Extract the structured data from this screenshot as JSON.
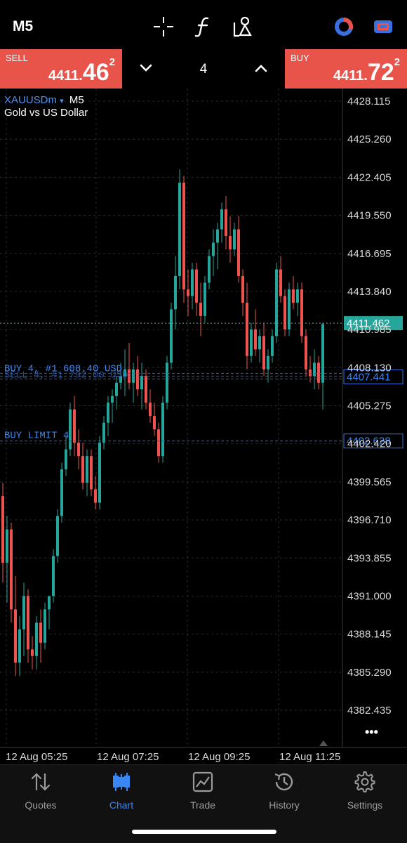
{
  "header": {
    "timeframe": "M5",
    "icons": [
      "crosshair-icon",
      "function-icon",
      "objects-icon",
      "account-icon",
      "switch-icon"
    ]
  },
  "trade_panel": {
    "sell": {
      "label": "SELL",
      "price_main": "4411.",
      "price_big": "46",
      "price_sup": "2"
    },
    "buy": {
      "label": "BUY",
      "price_main": "4411.",
      "price_big": "72",
      "price_sup": "2"
    },
    "quantity": "4"
  },
  "chart_info": {
    "symbol": "XAUUSDm",
    "symbol_arrow": "▾",
    "timeframe": "M5",
    "description": "Gold vs US Dollar"
  },
  "price_axis": {
    "ticks": [
      "4428.115",
      "4425.260",
      "4422.405",
      "4419.550",
      "4416.695",
      "4413.840",
      "4410.985",
      "4408.130",
      "4405.275",
      "4402.420",
      "4399.565",
      "4396.710",
      "4393.855",
      "4391.000",
      "4388.145",
      "4385.290",
      "4382.435"
    ],
    "current_price": "4411.462",
    "order_price": "4407.441",
    "limit_price": "4402.628"
  },
  "time_axis": {
    "ticks": [
      "12 Aug 05:25",
      "12 Aug 07:25",
      "12 Aug 09:25",
      "12 Aug 11:25"
    ]
  },
  "orders": {
    "buy_line_label": "BUY 4, #1 608.40 USD",
    "sell_line_label": "SELL 4, #1 792.00 USD",
    "limit_label": "BUY LIMIT 4"
  },
  "more_label": "•••",
  "colors": {
    "sell": "#e8534a",
    "buy": "#e8534a",
    "bull": "#26a69a",
    "bear": "#ef5350",
    "accent": "#3a86f5"
  },
  "chart_data": {
    "type": "candlestick",
    "symbol": "XAUUSDm",
    "ohlc": [
      [
        4398.5,
        4399.5,
        4392.0,
        4393.5
      ],
      [
        4393.5,
        4397.0,
        4390.5,
        4396.0
      ],
      [
        4396.0,
        4396.5,
        4389.0,
        4390.0
      ],
      [
        4390.0,
        4392.5,
        4385.0,
        4386.0
      ],
      [
        4386.0,
        4389.5,
        4385.0,
        4388.5
      ],
      [
        4388.5,
        4392.0,
        4386.5,
        4391.0
      ],
      [
        4391.0,
        4391.5,
        4386.0,
        4387.0
      ],
      [
        4387.0,
        4388.0,
        4385.5,
        4386.5
      ],
      [
        4386.5,
        4389.5,
        4385.5,
        4389.0
      ],
      [
        4389.0,
        4390.0,
        4386.0,
        4387.5
      ],
      [
        4387.5,
        4390.5,
        4387.0,
        4390.0
      ],
      [
        4390.0,
        4391.0,
        4388.5,
        4391.0
      ],
      [
        4391.0,
        4394.5,
        4390.5,
        4394.0
      ],
      [
        4394.0,
        4397.5,
        4393.5,
        4397.0
      ],
      [
        4397.0,
        4401.0,
        4396.5,
        4400.5
      ],
      [
        4400.5,
        4403.0,
        4400.0,
        4402.0
      ],
      [
        4402.0,
        4405.5,
        4401.5,
        4405.0
      ],
      [
        4405.0,
        4406.0,
        4401.5,
        4402.5
      ],
      [
        4402.5,
        4403.5,
        4400.5,
        4401.5
      ],
      [
        4401.5,
        4402.5,
        4399.0,
        4399.5
      ],
      [
        4399.5,
        4402.0,
        4398.5,
        4401.5
      ],
      [
        4401.5,
        4402.0,
        4398.5,
        4399.0
      ],
      [
        4399.0,
        4400.0,
        4397.5,
        4398.0
      ],
      [
        4398.0,
        4403.0,
        4397.5,
        4402.5
      ],
      [
        4402.5,
        4404.5,
        4402.0,
        4404.0
      ],
      [
        4404.0,
        4406.0,
        4403.0,
        4405.5
      ],
      [
        4405.5,
        4406.5,
        4404.0,
        4406.0
      ],
      [
        4406.0,
        4407.5,
        4405.0,
        4407.0
      ],
      [
        4407.0,
        4408.5,
        4406.5,
        4407.5
      ],
      [
        4407.5,
        4409.5,
        4406.0,
        4408.0
      ],
      [
        4408.0,
        4410.0,
        4406.5,
        4407.0
      ],
      [
        4407.0,
        4408.5,
        4405.5,
        4408.0
      ],
      [
        4408.0,
        4409.0,
        4406.0,
        4406.5
      ],
      [
        4406.5,
        4408.5,
        4405.0,
        4407.5
      ],
      [
        4407.5,
        4408.0,
        4405.0,
        4405.5
      ],
      [
        4405.5,
        4406.5,
        4404.0,
        4404.5
      ],
      [
        4404.5,
        4405.5,
        4403.0,
        4403.5
      ],
      [
        4403.5,
        4404.0,
        4401.0,
        4401.5
      ],
      [
        4401.5,
        4406.0,
        4401.0,
        4405.5
      ],
      [
        4405.5,
        4409.0,
        4405.0,
        4408.5
      ],
      [
        4408.5,
        4413.0,
        4408.0,
        4412.5
      ],
      [
        4412.5,
        4416.5,
        4411.0,
        4415.0
      ],
      [
        4415.0,
        4423.0,
        4414.0,
        4422.0
      ],
      [
        4422.0,
        4422.5,
        4413.0,
        4414.0
      ],
      [
        4414.0,
        4415.5,
        4412.0,
        4413.5
      ],
      [
        4413.5,
        4416.0,
        4412.5,
        4415.5
      ],
      [
        4415.5,
        4416.0,
        4412.0,
        4413.0
      ],
      [
        4413.0,
        4414.5,
        4410.5,
        4412.0
      ],
      [
        4412.0,
        4415.0,
        4411.5,
        4414.5
      ],
      [
        4414.5,
        4417.0,
        4414.0,
        4416.5
      ],
      [
        4416.5,
        4418.5,
        4415.0,
        4417.5
      ],
      [
        4417.5,
        4419.0,
        4415.5,
        4418.5
      ],
      [
        4418.5,
        4420.5,
        4417.5,
        4420.0
      ],
      [
        4420.0,
        4421.0,
        4417.0,
        4418.0
      ],
      [
        4418.0,
        4419.5,
        4416.0,
        4417.0
      ],
      [
        4417.0,
        4419.0,
        4416.5,
        4418.5
      ],
      [
        4418.5,
        4419.5,
        4414.5,
        4415.0
      ],
      [
        4415.0,
        4415.5,
        4412.0,
        4413.0
      ],
      [
        4413.0,
        4414.5,
        4408.0,
        4409.0
      ],
      [
        4409.0,
        4411.5,
        4408.5,
        4411.0
      ],
      [
        4411.0,
        4412.5,
        4409.0,
        4409.5
      ],
      [
        4409.5,
        4411.0,
        4408.5,
        4410.5
      ],
      [
        4410.5,
        4411.5,
        4407.5,
        4408.0
      ],
      [
        4408.0,
        4409.5,
        4407.0,
        4409.0
      ],
      [
        4409.0,
        4411.0,
        4408.5,
        4410.5
      ],
      [
        4410.5,
        4416.0,
        4410.0,
        4415.5
      ],
      [
        4415.5,
        4416.5,
        4413.0,
        4413.5
      ],
      [
        4413.5,
        4414.0,
        4410.5,
        4411.0
      ],
      [
        4411.0,
        4414.5,
        4410.5,
        4414.0
      ],
      [
        4414.0,
        4415.0,
        4412.5,
        4413.0
      ],
      [
        4413.0,
        4414.5,
        4412.0,
        4414.0
      ],
      [
        4414.0,
        4414.5,
        4410.0,
        4410.5
      ],
      [
        4410.5,
        4411.0,
        4407.5,
        4408.0
      ],
      [
        4408.0,
        4409.0,
        4407.0,
        4407.5
      ],
      [
        4407.5,
        4409.5,
        4406.5,
        4408.5
      ],
      [
        4408.5,
        4409.0,
        4406.5,
        4407.0
      ],
      [
        4407.0,
        4411.5,
        4405.0,
        4411.4
      ]
    ],
    "ylim": [
      4380.5,
      4429.5
    ],
    "current_price": 4411.462,
    "order_price": 4407.441,
    "limit_price": 4402.628
  }
}
